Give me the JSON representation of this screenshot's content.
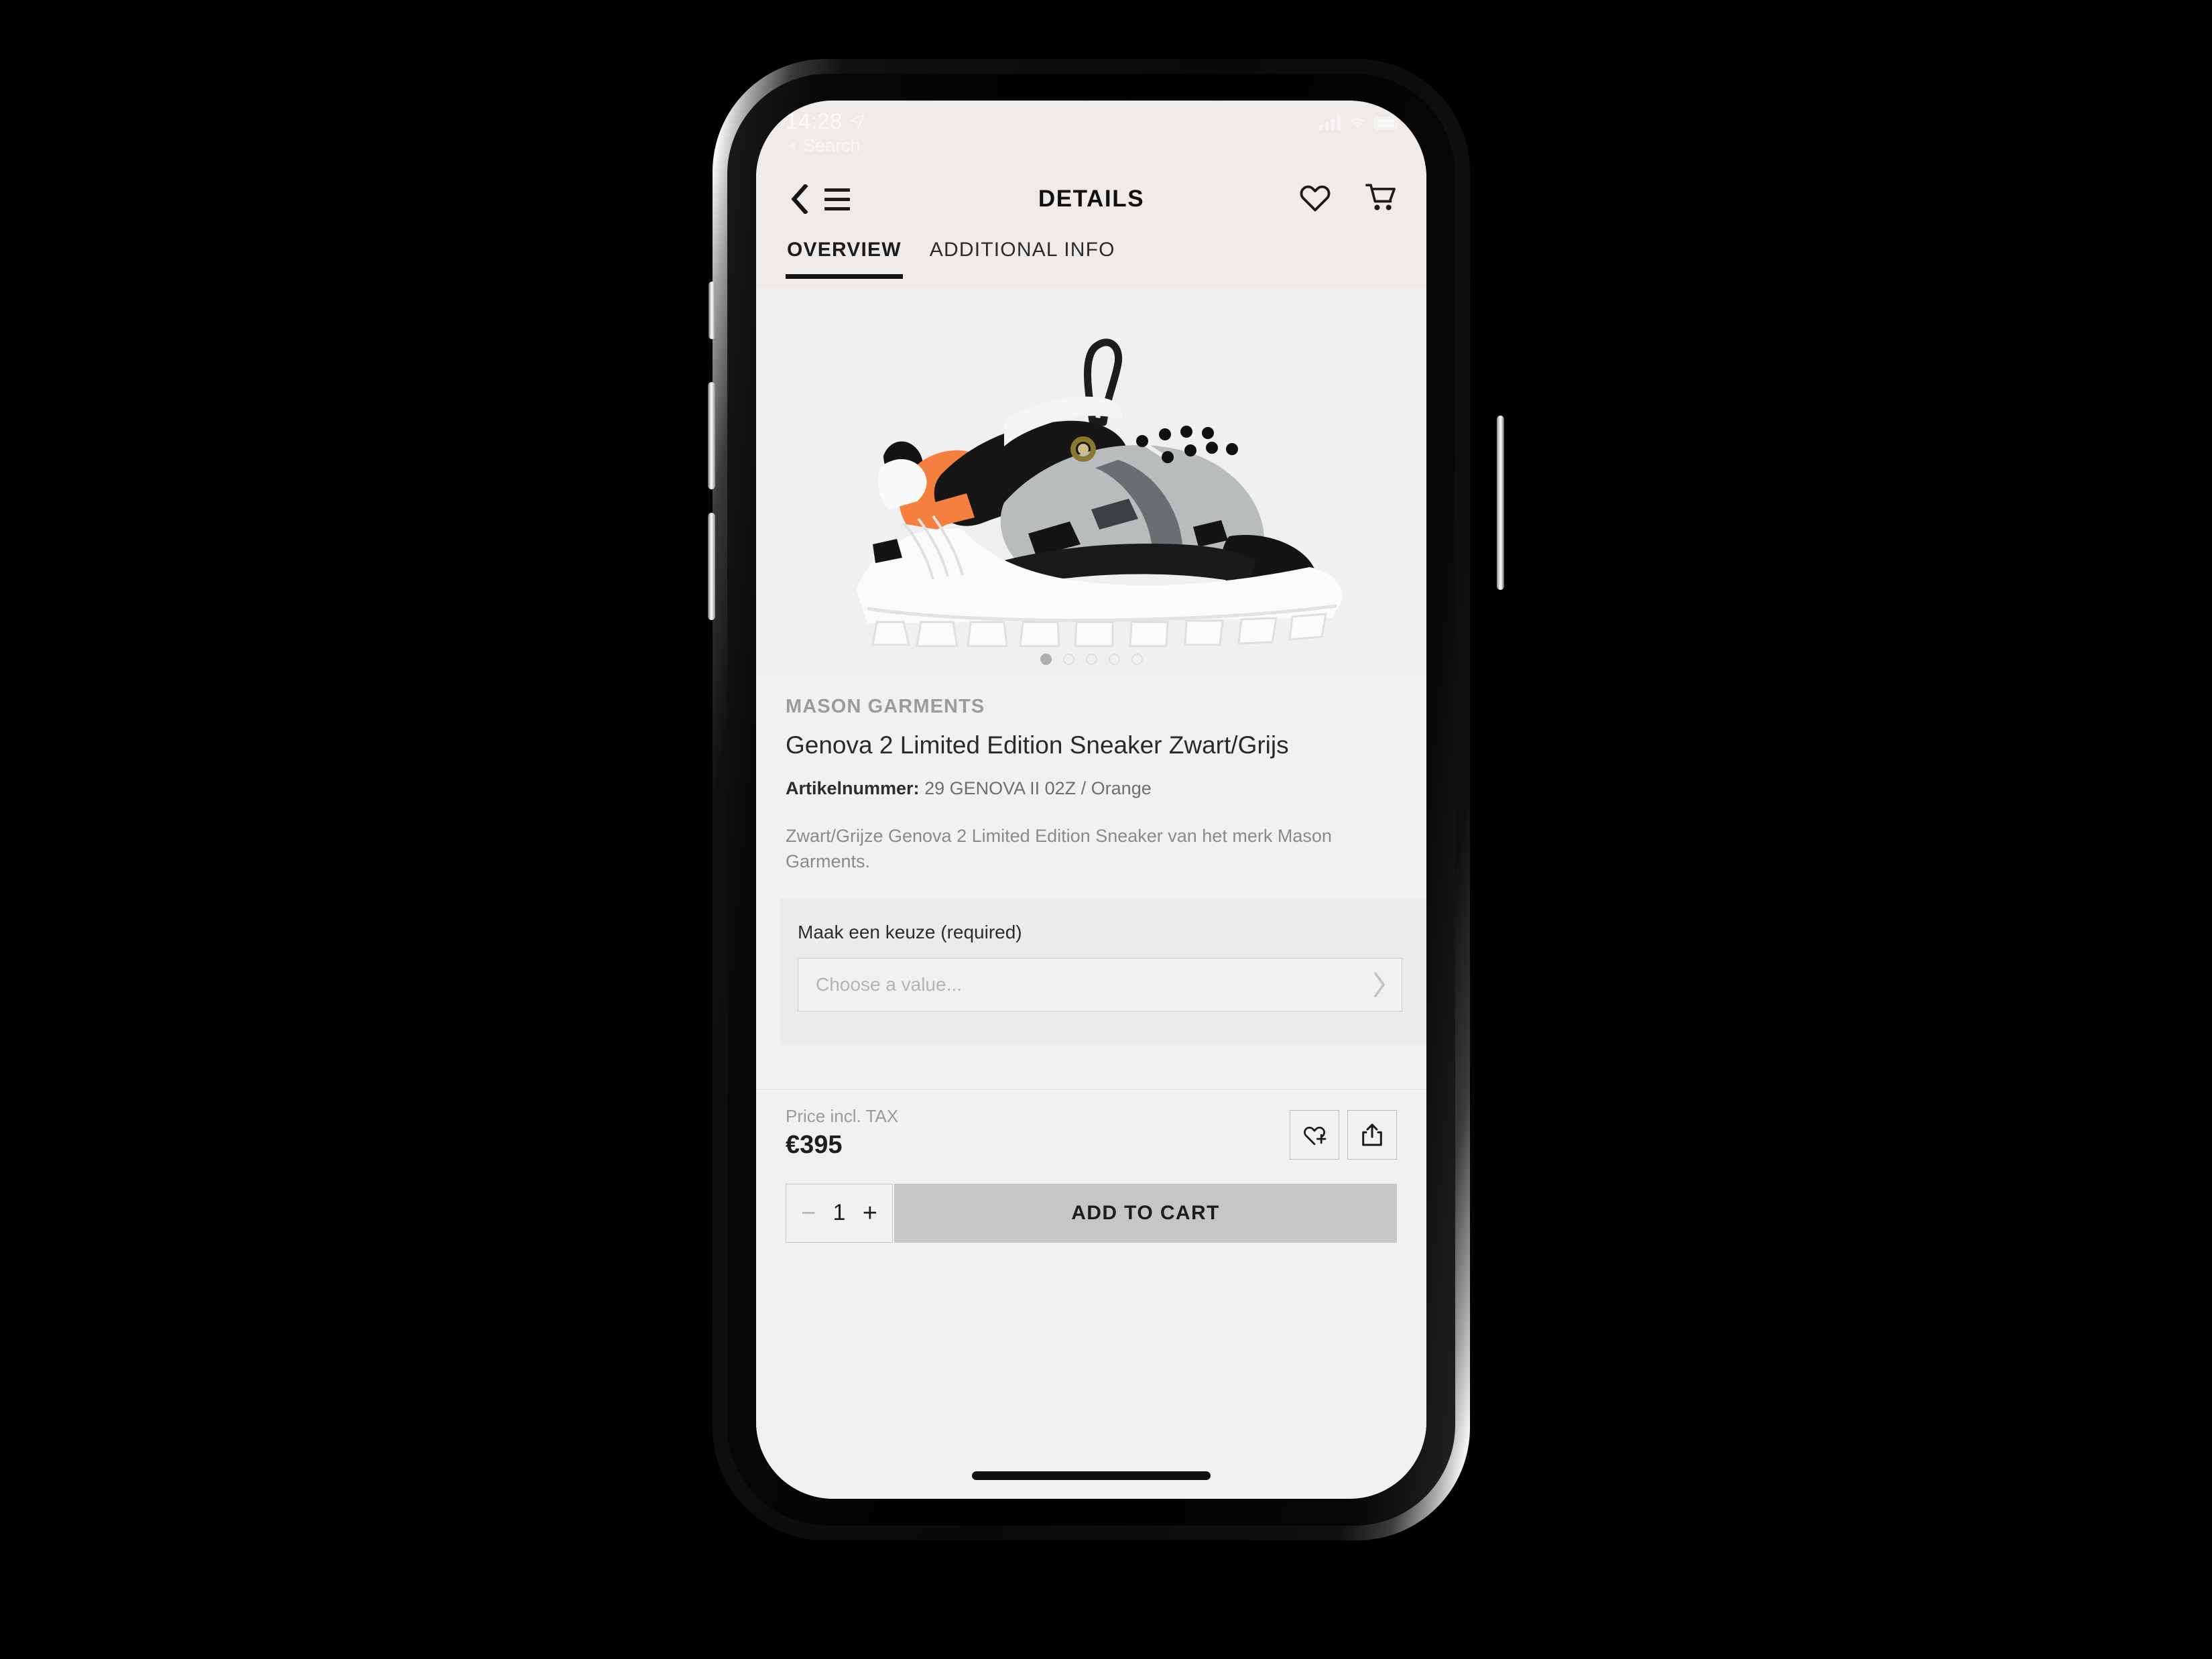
{
  "status_bar": {
    "time": "14:28",
    "location_icon": "location-arrow-icon",
    "back_app_label": "Search",
    "back_app_icon": "triangle-left-icon",
    "signal_icon": "cellular-signal-icon",
    "wifi_icon": "wifi-icon",
    "battery_icon": "battery-icon"
  },
  "nav": {
    "title": "DETAILS",
    "back_icon": "chevron-left-icon",
    "menu_icon": "hamburger-menu-icon",
    "wishlist_icon": "heart-icon",
    "cart_icon": "shopping-cart-icon"
  },
  "tabs": [
    {
      "label": "OVERVIEW",
      "active": true
    },
    {
      "label": "ADDITIONAL INFO",
      "active": false
    }
  ],
  "gallery": {
    "image_alt": "Genova 2 Limited Edition Sneaker Zwart/Grijs",
    "dot_count": 5,
    "active_dot": 1
  },
  "product": {
    "brand": "MASON GARMENTS",
    "title": "Genova 2 Limited Edition Sneaker Zwart/Grijs",
    "sku_label": "Artikelnummer:",
    "sku_value": "29 GENOVA II 02Z / Orange",
    "description": "Zwart/Grijze Genova 2 Limited Edition Sneaker van het merk Mason Garments."
  },
  "options": {
    "label": "Maak een keuze (required)",
    "placeholder": "Choose a value...",
    "value": "",
    "chevron_icon": "chevron-right-icon"
  },
  "price": {
    "label": "Price incl. TAX",
    "value": "€395",
    "wishlist_add_icon": "heart-plus-icon",
    "share_icon": "share-icon"
  },
  "cart": {
    "qty_minus": "−",
    "qty_value": "1",
    "qty_plus": "+",
    "add_to_cart_label": "ADD TO CART"
  },
  "colors": {
    "header_bg": "#eeebe8",
    "page_bg": "#f1f1f1",
    "options_bg": "#ebebeb",
    "cta_bg": "#c6c6c6",
    "accent_orange": "#f57f3f",
    "text_primary": "#1e1e1e",
    "text_muted": "#9b9b9b"
  }
}
